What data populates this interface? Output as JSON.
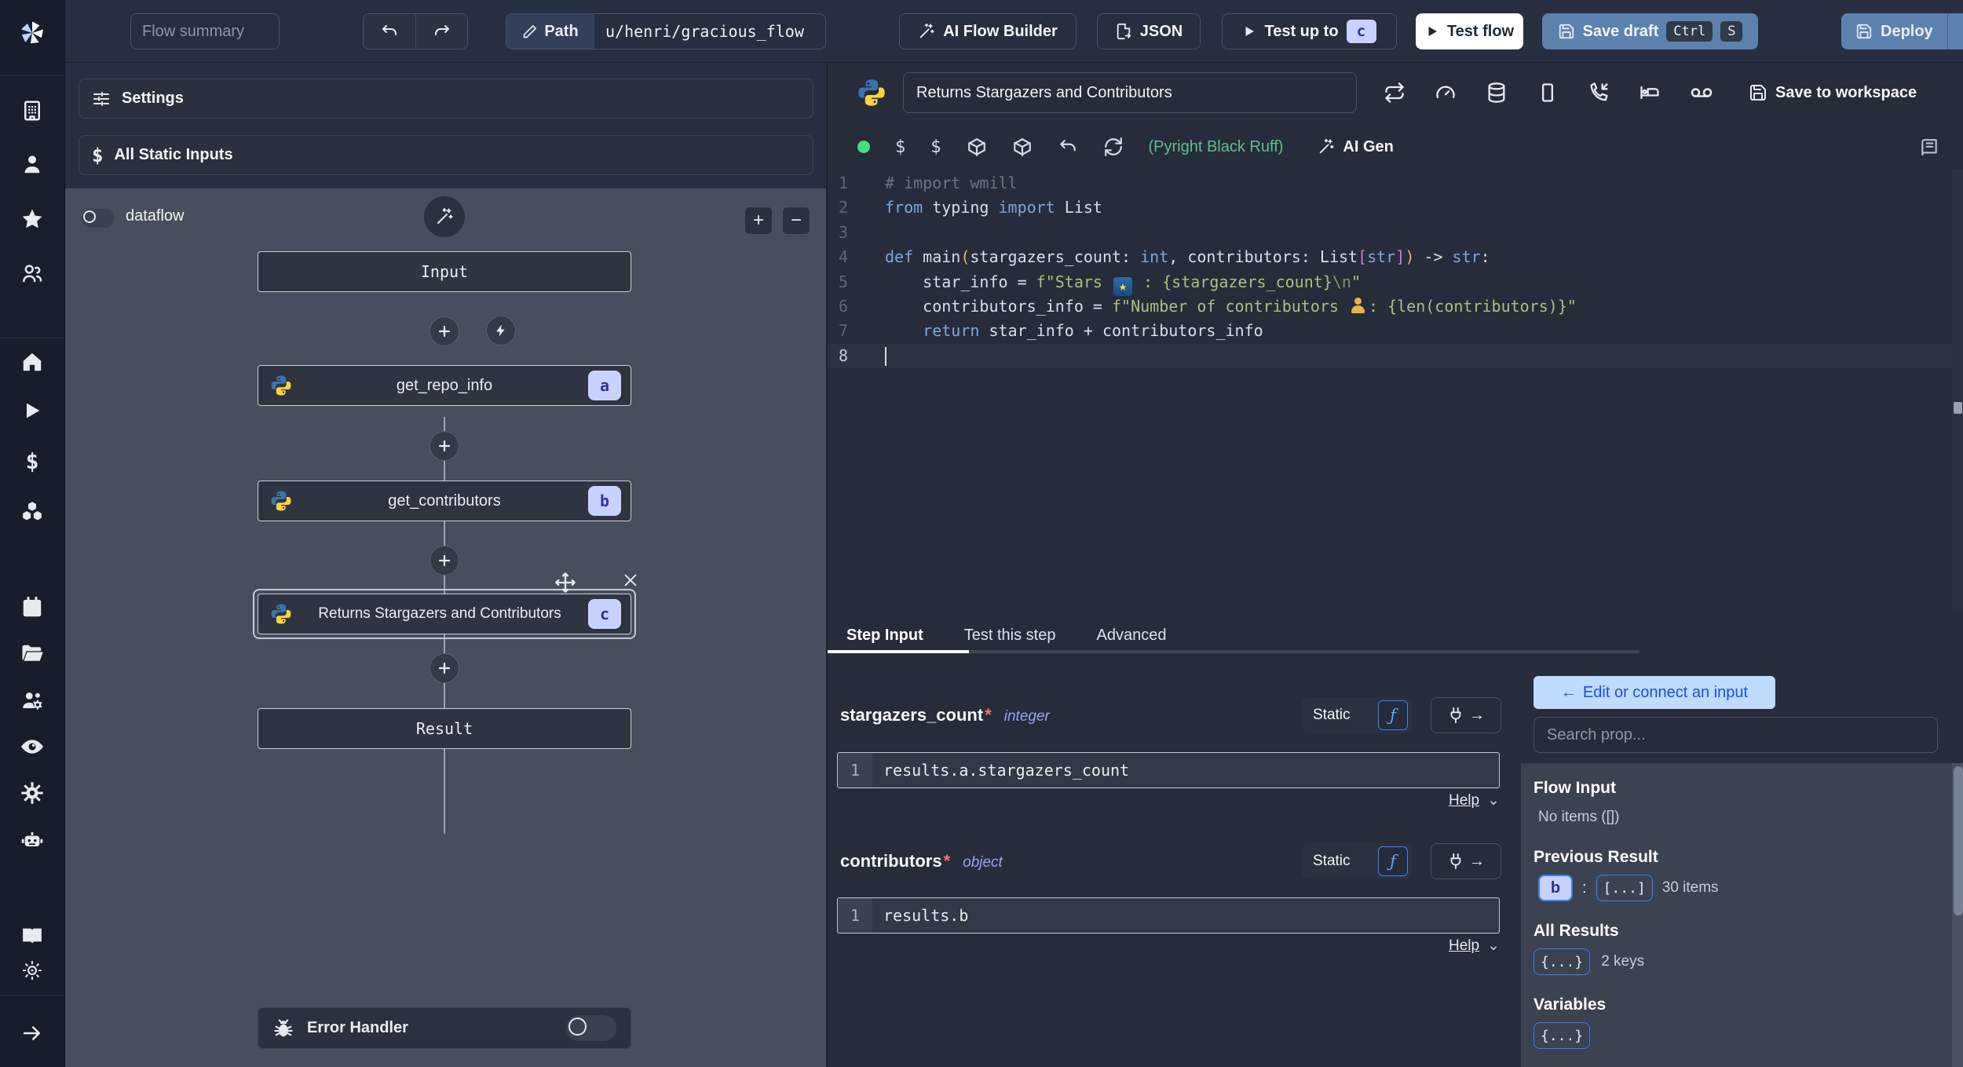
{
  "topbar": {
    "flow_summary_placeholder": "Flow summary",
    "path_label": "Path",
    "path_value": "u/henri/gracious_flow",
    "ai_flow_builder": "AI Flow Builder",
    "json_button": "JSON",
    "test_up_to": "Test up to",
    "test_up_to_badge": "c",
    "test_flow": "Test flow",
    "save_draft": "Save draft",
    "kbd_ctrl": "Ctrl",
    "kbd_s": "S",
    "deploy": "Deploy"
  },
  "sidebar": {
    "icons": [
      "windmill-logo",
      "building",
      "user",
      "star",
      "users",
      "home",
      "play",
      "dollar",
      "boxes",
      "calendar",
      "folder-open",
      "users-cog",
      "eye",
      "settings-gear",
      "robot",
      "book-open",
      "sun",
      "arrow-right"
    ],
    "dollar_glyph": "$"
  },
  "flow_panel": {
    "settings_label": "Settings",
    "static_inputs_label": "All Static Inputs",
    "dataflow_label": "dataflow",
    "zoom_in": "+",
    "zoom_out": "−",
    "nodes": {
      "input_label": "Input",
      "steps": [
        {
          "id": "a",
          "label": "get_repo_info"
        },
        {
          "id": "b",
          "label": "get_contributors"
        },
        {
          "id": "c",
          "label": "Returns Stargazers and Contributors"
        }
      ],
      "result_label": "Result"
    },
    "error_handler_label": "Error Handler"
  },
  "editor": {
    "language": "python",
    "title": "Returns Stargazers and Contributors",
    "assistants": "(Pyright Black Ruff)",
    "ai_gen": "AI Gen",
    "save_to_workspace": "Save to workspace",
    "dollar1": "$",
    "dollar2": "$",
    "code_lines": [
      {
        "n": "1",
        "tokens": [
          [
            "com",
            "# import wmill"
          ]
        ]
      },
      {
        "n": "2",
        "tokens": [
          [
            "kw",
            "from"
          ],
          [
            "pln",
            " typing "
          ],
          [
            "kw",
            "import"
          ],
          [
            "pln",
            " List"
          ]
        ]
      },
      {
        "n": "3",
        "tokens": []
      },
      {
        "n": "4",
        "tokens": [
          [
            "kw",
            "def"
          ],
          [
            "pln",
            " main"
          ],
          [
            "par",
            "("
          ],
          [
            "pln",
            "stargazers_count: "
          ],
          [
            "typ",
            "int"
          ],
          [
            "pln",
            ", contributors: List"
          ],
          [
            "brk",
            "["
          ],
          [
            "typ",
            "str"
          ],
          [
            "brk",
            "]"
          ],
          [
            "par",
            ")"
          ],
          [
            "pln",
            " -> "
          ],
          [
            "typ",
            "str"
          ],
          [
            "pln",
            ":"
          ]
        ]
      },
      {
        "n": "5",
        "tokens": [
          [
            "pln",
            "    star_info = "
          ],
          [
            "str",
            "f\"Stars "
          ],
          [
            "estar",
            "★"
          ],
          [
            "str",
            " : {stargazers_count}"
          ],
          [
            "esc",
            "\\n"
          ],
          [
            "str",
            "\""
          ]
        ]
      },
      {
        "n": "6",
        "tokens": [
          [
            "pln",
            "    contributors_info = "
          ],
          [
            "str",
            "f\"Number of contributors "
          ],
          [
            "epeople",
            ""
          ],
          [
            "str",
            ": {len(contributors)}\""
          ]
        ]
      },
      {
        "n": "7",
        "tokens": [
          [
            "pln",
            "    "
          ],
          [
            "kw",
            "return"
          ],
          [
            "pln",
            " star_info + contributors_info"
          ]
        ]
      },
      {
        "n": "8",
        "current": true,
        "tokens": []
      }
    ]
  },
  "step_panel": {
    "tabs": [
      "Step Input",
      "Test this step",
      "Advanced"
    ],
    "active_tab": "Step Input",
    "fields": [
      {
        "name": "stargazers_count",
        "required": "*",
        "type": "integer",
        "mode": "Static",
        "fn": "ƒ",
        "line": "1",
        "value": "results.a.stargazers_count",
        "help": "Help"
      },
      {
        "name": "contributors",
        "required": "*",
        "type": "object",
        "mode": "Static",
        "fn": "ƒ",
        "line": "1",
        "value": "results.b",
        "help": "Help"
      }
    ]
  },
  "connect_panel": {
    "back_arrow": "←",
    "edit_button": "Edit or connect an input",
    "search_placeholder": "Search prop...",
    "flow_input_title": "Flow Input",
    "flow_input_empty": "No items ([])",
    "previous_result_title": "Previous Result",
    "prev_badge": "b",
    "prev_sep": ":",
    "prev_array": "[...]",
    "prev_count": "30 items",
    "all_results_title": "All Results",
    "all_obj": "{...}",
    "all_count": "2 keys",
    "variables_title": "Variables",
    "vars_obj": "{...}"
  },
  "colors": {
    "canvas": "#474E5D",
    "action_blue": "#5D81AE",
    "badge_bg": "#C7D2FE",
    "badge_text": "#312E81",
    "connect_btn_bg": "#BFDBFE",
    "connect_btn_text": "#1D4ED8",
    "assistant_green": "#5FBE8C",
    "border_blue": "#3B82F6"
  }
}
